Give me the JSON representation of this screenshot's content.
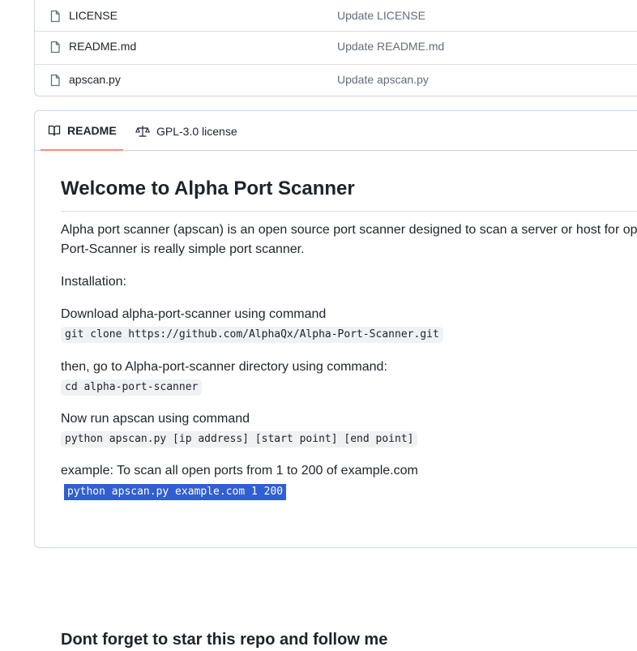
{
  "files": [
    {
      "name": "LICENSE",
      "commit": "Update LICENSE"
    },
    {
      "name": "README.md",
      "commit": "Update README.md"
    },
    {
      "name": "apscan.py",
      "commit": "Update apscan.py"
    }
  ],
  "tabs": {
    "readme": "README",
    "license": "GPL-3.0 license"
  },
  "readme": {
    "title": "Welcome to Alpha Port Scanner",
    "intro_line1": "Alpha port scanner (apscan) is an open source port scanner designed to scan a server or host for op",
    "intro_line2": "Port-Scanner is really simple port scanner.",
    "installation": "Installation:",
    "download_text": "Download alpha-port-scanner using command",
    "download_cmd": "git clone https://github.com/AlphaQx/Alpha-Port-Scanner.git",
    "cd_text": "then, go to Alpha-port-scanner directory using command:",
    "cd_cmd": "cd alpha-port-scanner",
    "run_text": "Now run apscan using command",
    "run_cmd": "python apscan.py [ip address] [start point] [end point]",
    "example_text": "example: To scan all open ports from 1 to 200 of example.com",
    "example_cmd": "python apscan.py example.com 1 200",
    "subheading": "Dont forget to star this repo and follow me"
  },
  "colors": {
    "accent_tab_underline": "#fd8c73",
    "selection": "#2f5fd0"
  }
}
